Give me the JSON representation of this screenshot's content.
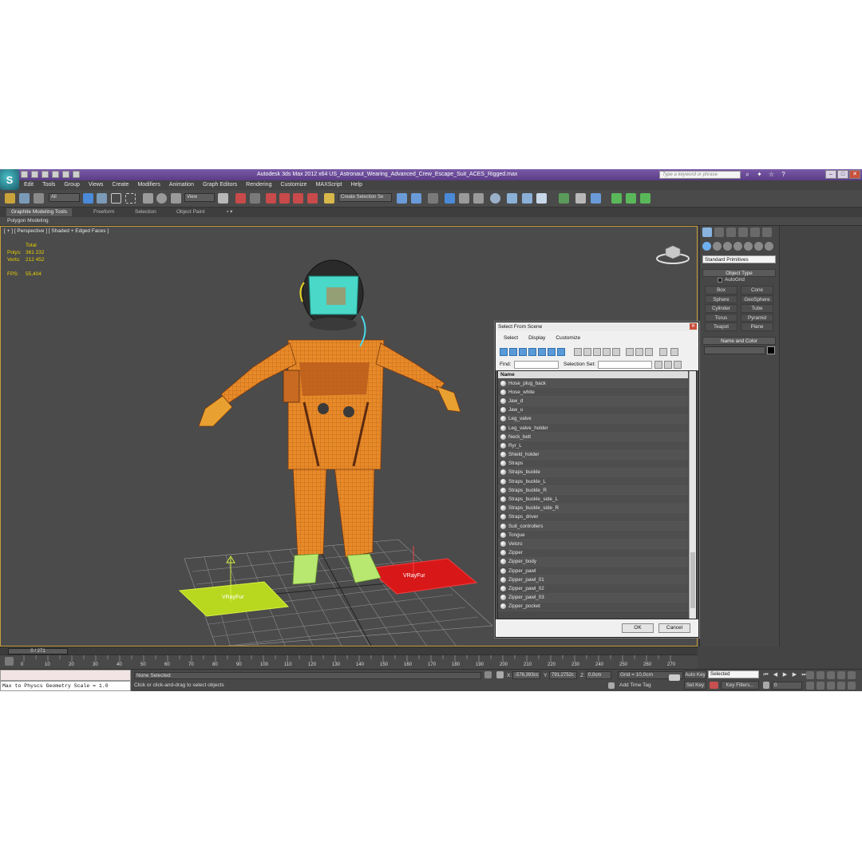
{
  "window": {
    "title": "Autodesk 3ds Max  2012 x64      US_Astronaut_Wearing_Advanced_Crew_Escape_Suit_ACES_Rigged.max",
    "search_placeholder": "Type a keyword or phrase",
    "logo_glyph": "S"
  },
  "menu": [
    "Edit",
    "Tools",
    "Group",
    "Views",
    "Create",
    "Modifiers",
    "Animation",
    "Graph Editors",
    "Rendering",
    "Customize",
    "MAXScript",
    "Help"
  ],
  "toolbar": {
    "filter_value": "All",
    "ref_coord_value": "View",
    "named_selection_placeholder": "Create Selection Se"
  },
  "ribbon": {
    "tabs": [
      "Graphite Modeling Tools",
      "Freeform",
      "Selection",
      "Object Paint"
    ],
    "active_panel": "Polygon Modeling"
  },
  "viewport": {
    "label": "[ + ] [ Perspective ] [ Shaded + Edged Faces ]",
    "stats": {
      "total_label": "Total",
      "polys_label": "Polys:",
      "polys_value": "361 232",
      "verts_label": "Verts:",
      "verts_value": "212 452",
      "fps_label": "FPS:",
      "fps_value": "55,404"
    },
    "helper_labels": [
      "VRayFur",
      "VRayFur"
    ]
  },
  "dialog": {
    "title": "Select From Scene",
    "menu": [
      "Select",
      "Display",
      "Customize"
    ],
    "find_label": "Find:",
    "selection_set_label": "Selection Set:",
    "column_header": "Name",
    "items": [
      "Hose_plug_back",
      "Hose_white",
      "Jaw_d",
      "Jaw_u",
      "Leg_valve",
      "Leg_valve_holder",
      "Neck_belt",
      "Ryr_L",
      "Shield_holder",
      "Straps",
      "Straps_buckle",
      "Straps_buckle_L",
      "Straps_buckle_R",
      "Straps_buckle_side_L",
      "Straps_buckle_side_R",
      "Straps_driver",
      "Suit_controllers",
      "Tongue",
      "Velcro",
      "Zipper",
      "Zipper_body",
      "Zipper_pawl",
      "Zipper_pawl_01",
      "Zipper_pawl_02",
      "Zipper_pawl_03",
      "Zipper_pocket"
    ],
    "ok_label": "OK",
    "cancel_label": "Cancel"
  },
  "command_panel": {
    "category_value": "Standard Primitives",
    "object_type_header": "Object Type",
    "autogrid_label": "AutoGrid",
    "buttons": [
      "Box",
      "Cone",
      "Sphere",
      "GeoSphere",
      "Cylinder",
      "Tube",
      "Torus",
      "Pyramid",
      "Teapot",
      "Plane"
    ],
    "name_color_header": "Name and Color"
  },
  "timeline": {
    "slider_label": "0 / 271",
    "ticks": [
      "0",
      "10",
      "20",
      "30",
      "40",
      "50",
      "60",
      "70",
      "80",
      "90",
      "100",
      "110",
      "120",
      "130",
      "140",
      "150",
      "160",
      "170",
      "180",
      "190",
      "200",
      "210",
      "220",
      "230",
      "240",
      "250",
      "260",
      "270"
    ]
  },
  "status": {
    "maxscript_line": "Max to Physcs Geometry Scale = 1.0",
    "selection": "None Selected",
    "prompt": "Click or click-and-drag to select objects",
    "x_label": "X:",
    "x_value": "-576,393cc",
    "y_label": "Y:",
    "y_value": "791,2752c",
    "z_label": "Z:",
    "z_value": "0,0cm",
    "grid": "Grid = 10,0cm",
    "add_time_tag": "Add Time Tag",
    "auto_key": "Auto Key",
    "selected_value": "Selected",
    "set_key": "Set Key",
    "key_filters": "Key Filters...",
    "frame_value": "0"
  },
  "colors": {
    "title_bar": "#6a4a98",
    "viewport_border": "#c8a03c",
    "suit_orange": "#e88a28",
    "helper_yellow": "#b8d820",
    "helper_red": "#d81818"
  }
}
